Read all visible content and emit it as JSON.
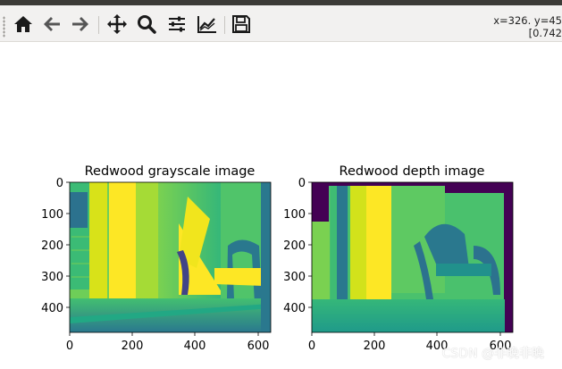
{
  "toolbar": {
    "buttons": [
      {
        "name": "home-button",
        "icon": "home-icon",
        "tooltip": "Home"
      },
      {
        "name": "back-button",
        "icon": "arrow-left-icon",
        "tooltip": "Back"
      },
      {
        "name": "forward-button",
        "icon": "arrow-right-icon",
        "tooltip": "Forward"
      },
      {
        "name": "pan-button",
        "icon": "move-icon",
        "tooltip": "Pan"
      },
      {
        "name": "zoom-button",
        "icon": "magnifier-icon",
        "tooltip": "Zoom"
      },
      {
        "name": "subplots-button",
        "icon": "sliders-icon",
        "tooltip": "Configure subplots"
      },
      {
        "name": "edit-axis-button",
        "icon": "line-chart-icon",
        "tooltip": "Edit axis"
      },
      {
        "name": "save-button",
        "icon": "floppy-disk-icon",
        "tooltip": "Save"
      }
    ],
    "coords_line1": "x=326. y=45",
    "coords_line2": "[0.742"
  },
  "figure": {
    "subplots": [
      {
        "title": "Redwood grayscale image",
        "xticks": [
          "0",
          "200",
          "400",
          "600"
        ],
        "yticks": [
          "0",
          "100",
          "200",
          "300",
          "400"
        ]
      },
      {
        "title": "Redwood depth image",
        "xticks": [
          "0",
          "200",
          "400",
          "600"
        ],
        "yticks": [
          "0",
          "100",
          "200",
          "300",
          "400"
        ]
      }
    ]
  },
  "watermark": "CSDN @非晚非晚",
  "colors": {
    "toolbar_bg": "#f2f1f0",
    "viridis_dark": "#440154",
    "viridis_yellow": "#fde725",
    "viridis_green": "#5ec962",
    "viridis_teal": "#21918c"
  }
}
